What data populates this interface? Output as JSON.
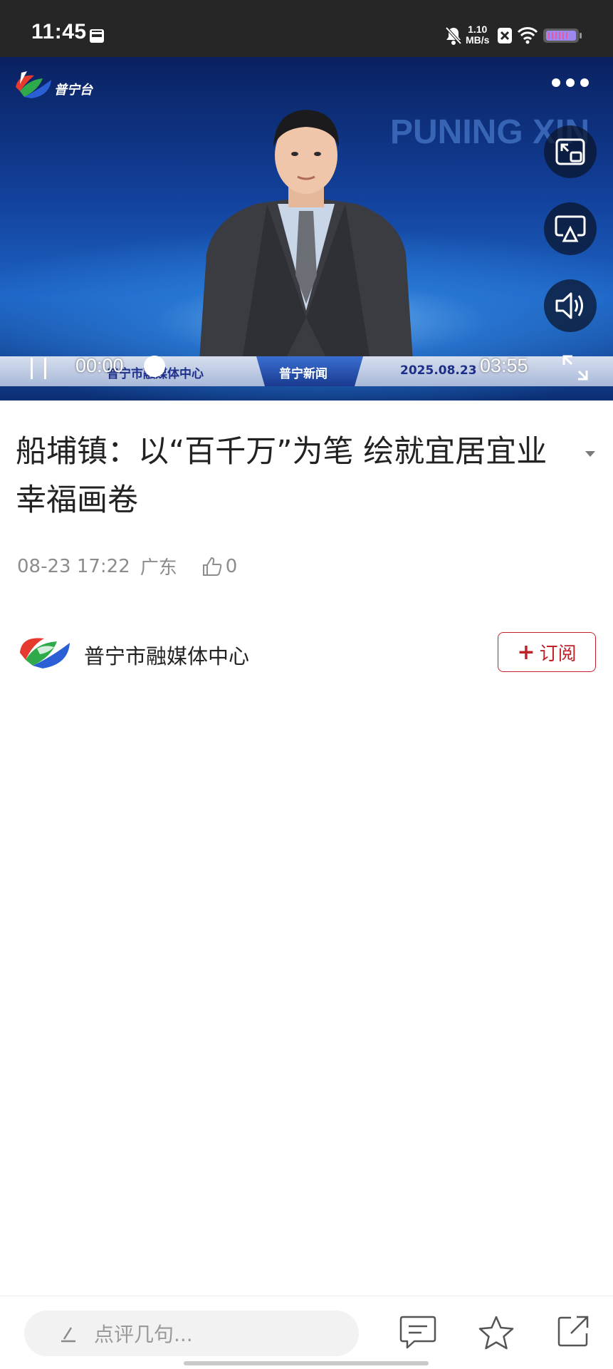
{
  "status_bar": {
    "time": "11:45",
    "net_speed_value": "1.10",
    "net_speed_unit": "MB/s",
    "icons": [
      "calendar-icon",
      "mute-icon",
      "close-box-icon",
      "wifi-icon",
      "battery-icon"
    ]
  },
  "video": {
    "channel_name": "普宁台",
    "background_text": "PUNING XIN",
    "ticker_left": "普宁市融媒体中心",
    "ticker_center": "普宁新闻",
    "ticker_right": "2025.08.23",
    "current_time": "00:00",
    "duration": "03:55",
    "progress": 0,
    "icons": [
      "more-icon",
      "pip-icon",
      "cast-icon",
      "volume-icon",
      "pause-icon",
      "fullscreen-icon"
    ]
  },
  "article": {
    "title": "船埔镇：以“百千万”为笔 绘就宜居宜业幸福画卷",
    "date": "08-23 17:22",
    "region": "广东",
    "likes": "0"
  },
  "publisher": {
    "name": "普宁市融媒体中心",
    "subscribe_label": "订阅"
  },
  "bottom_bar": {
    "comment_placeholder": "点评几句...",
    "icons": [
      "comment-icon",
      "star-icon",
      "share-icon"
    ]
  },
  "colors": {
    "status_bar_bg": "#262626",
    "accent_red": "#c0222a",
    "meta_gray": "#8c8c8c"
  }
}
